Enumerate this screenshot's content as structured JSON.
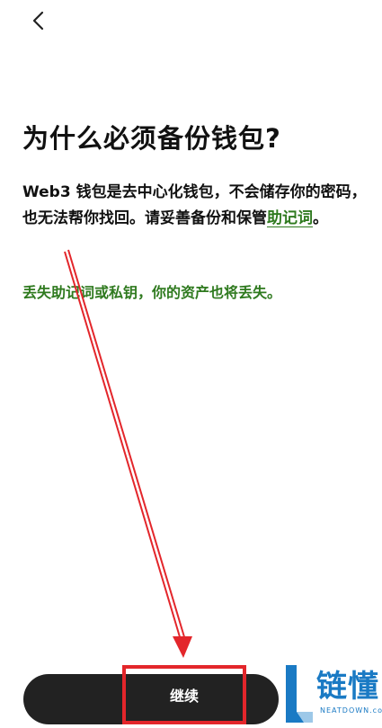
{
  "header": {
    "back_icon": "chevron-left-icon"
  },
  "page": {
    "title": "为什么必须备份钱包?",
    "description_before_link": "Web3 钱包是去中心化钱包，不会储存你的密码，也无法帮你找回。请妥善备份和保管",
    "description_link": "助记词",
    "description_after_link": "。",
    "warning": "丢失助记词或私钥，你的资产也将丢失。"
  },
  "footer": {
    "continue_label": "继续"
  },
  "watermark": {
    "brand": "链懂",
    "sub": "NEATDOWN.com"
  },
  "colors": {
    "accent_green": "#2f7a1f",
    "annotation_red": "#e3262b",
    "button_dark": "#222222",
    "watermark_blue": "#1a7ac4"
  }
}
